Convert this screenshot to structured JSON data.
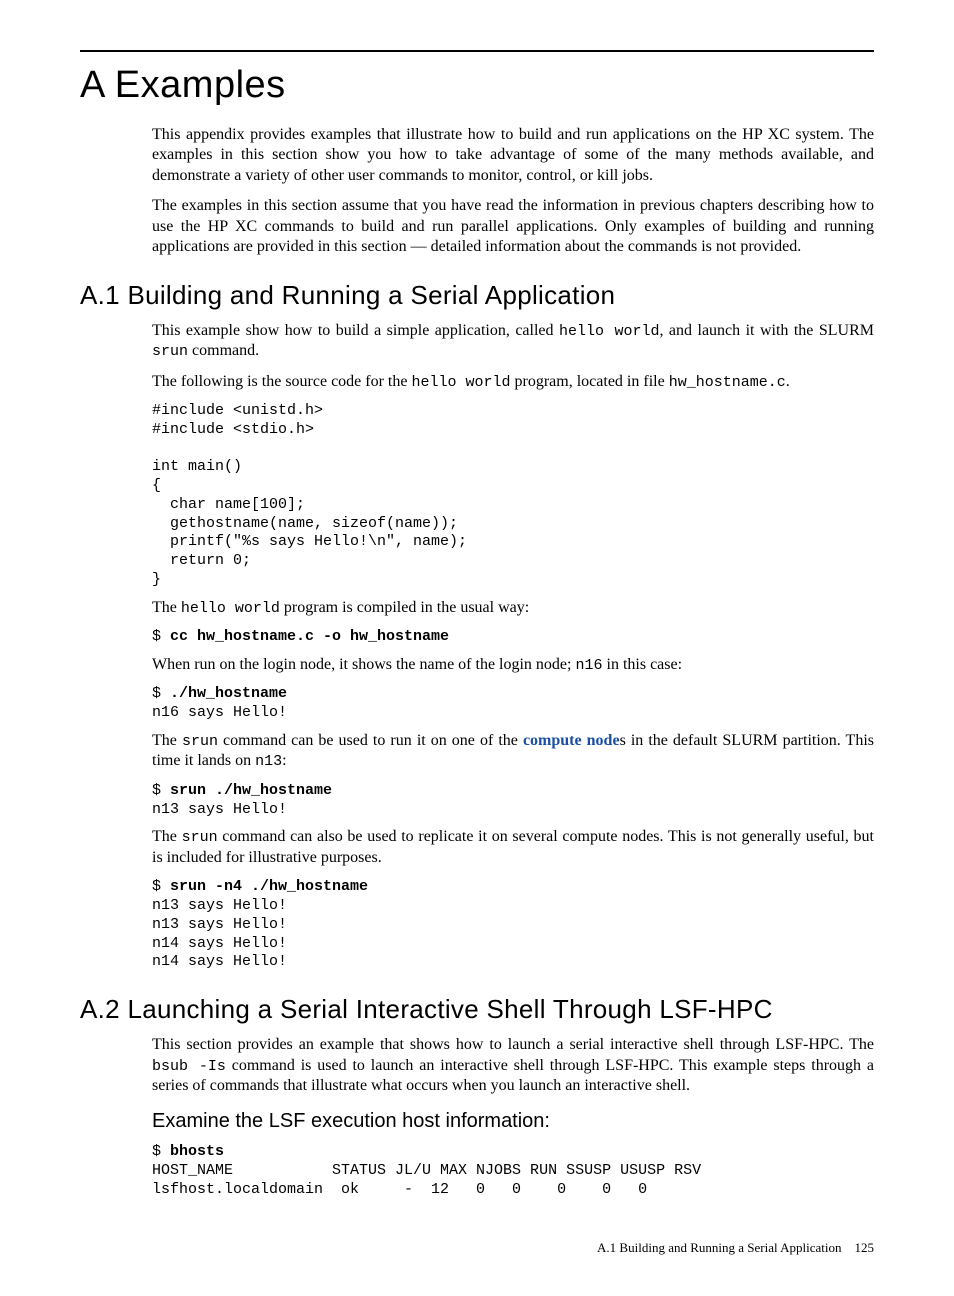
{
  "appendix_title": "A Examples",
  "intro_p1_a": "This appendix provides examples that illustrate how to build and run applications on the HP XC system. The examples in this section show you how to take advantage of some of the many methods available, and demonstrate a variety of other user commands to monitor, control, or kill jobs.",
  "intro_p2_a": "The examples in this section assume that you have read the information in previous chapters describing how to use the HP XC commands to build and run parallel applications. Only examples of building and running applications are provided in this section — detailed information about the commands is not provided.",
  "a1": {
    "heading": "A.1  Building and Running a Serial Application",
    "p1_a": "This example show how to build a simple application, called ",
    "p1_code1": "hello world",
    "p1_b": ", and launch it with the SLURM ",
    "p1_code2": "srun",
    "p1_c": " command.",
    "p2_a": "The following is the source code for the ",
    "p2_code1": "hello world",
    "p2_b": " program, located in file ",
    "p2_code2": "hw_hostname.c",
    "p2_c": ".",
    "src": "#include <unistd.h>\n#include <stdio.h>\n\nint main()\n{\n  char name[100];\n  gethostname(name, sizeof(name));\n  printf(\"%s says Hello!\\n\", name);\n  return 0;\n}",
    "p3_a": "The ",
    "p3_code1": "hello world",
    "p3_b": " program is compiled in the usual way:",
    "compile_prompt": "$ ",
    "compile_cmd": "cc hw_hostname.c -o hw_hostname",
    "p4_a": "When run on the login node, it shows the name of the login node; ",
    "p4_code1": "n16",
    "p4_b": " in this case:",
    "run1_prompt": "$ ",
    "run1_cmd": "./hw_hostname",
    "run1_out": "n16 says Hello!",
    "p5_a": "The ",
    "p5_code1": "srun",
    "p5_b": " command can be used to run it on one of the ",
    "p5_link": "compute node",
    "p5_c": "s in the default SLURM partition. This time it lands on ",
    "p5_code2": "n13",
    "p5_d": ":",
    "run2_prompt": "$ ",
    "run2_cmd": "srun ./hw_hostname",
    "run2_out": "n13 says Hello!",
    "p6_a": "The ",
    "p6_code1": "srun",
    "p6_b": " command can also be used to replicate it on several compute nodes. This is not generally useful, but is included for illustrative purposes.",
    "run3_prompt": "$ ",
    "run3_cmd": "srun -n4 ./hw_hostname",
    "run3_out": "n13 says Hello!\nn13 says Hello!\nn14 says Hello!\nn14 says Hello!"
  },
  "a2": {
    "heading": "A.2  Launching a Serial Interactive Shell Through LSF-HPC",
    "p1_a": "This section provides an example that shows how to launch a serial interactive shell through LSF-HPC. The ",
    "p1_code1": "bsub -Is",
    "p1_b": " command is used to launch an interactive shell through LSF-HPC. This example steps through a series of commands that illustrate what occurs when you launch an interactive shell.",
    "sub_heading": "Examine the LSF execution host information:",
    "bhosts_prompt": "$ ",
    "bhosts_cmd": "bhosts",
    "bhosts_out": "HOST_NAME           STATUS JL/U MAX NJOBS RUN SSUSP USUSP RSV\nlsfhost.localdomain  ok     -  12   0   0    0    0   0"
  },
  "footer": {
    "text": "A.1 Building and Running a Serial Application",
    "page": "125"
  }
}
